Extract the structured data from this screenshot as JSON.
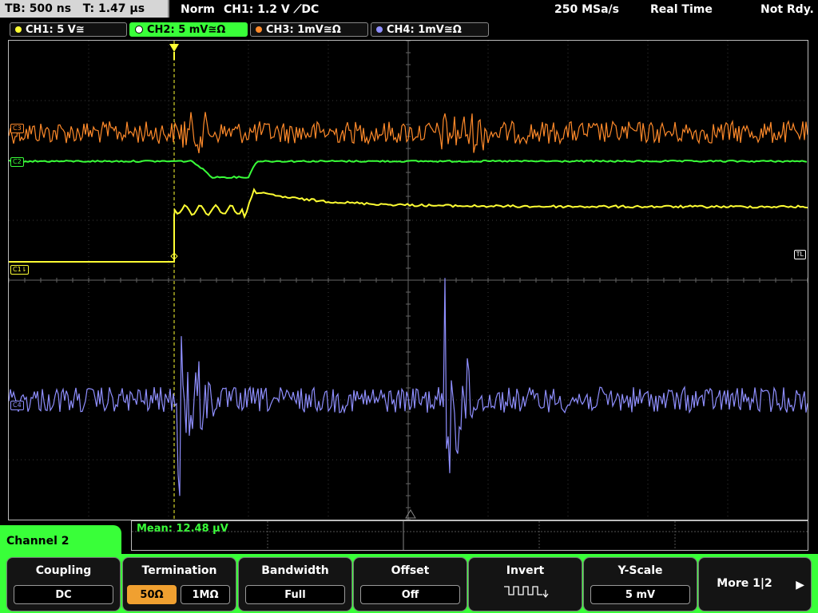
{
  "topbar": {
    "timebase": "TB: 500 ns",
    "trigger_pos": "T: 1.47 µs",
    "mode": "Norm",
    "trigger_info": "CH1: 1.2 V ⟋DC",
    "sample_rate": "250 MSa/s",
    "acq_mode": "Real Time",
    "status": "Not Rdy."
  },
  "channels": [
    {
      "label": "CH1: 5 V≅",
      "color": "#ffff33",
      "active": false
    },
    {
      "label": "CH2: 5 mV≅Ω",
      "color": "#39ff39",
      "active": true
    },
    {
      "label": "CH3: 1mV≅Ω",
      "color": "#ff8a2a",
      "active": false
    },
    {
      "label": "CH4: 1mV≅Ω",
      "color": "#8f8fff",
      "active": false
    }
  ],
  "waveform_markers": {
    "c1": "C1⇂",
    "c2": "C2",
    "c3": "C3",
    "c4": "C4",
    "trigger_level": "TL"
  },
  "measurement": {
    "mean": "Mean: 12.48 µV"
  },
  "panel_title": "Channel 2",
  "softkeys": {
    "coupling": {
      "label": "Coupling",
      "value": "DC"
    },
    "termination": {
      "label": "Termination",
      "opt1": "50Ω",
      "opt2": "1MΩ",
      "selected": "50Ω"
    },
    "bandwidth": {
      "label": "Bandwidth",
      "value": "Full"
    },
    "offset": {
      "label": "Offset",
      "value": "Off"
    },
    "invert": {
      "label": "Invert"
    },
    "yscale": {
      "label": "Y-Scale",
      "value": "5 mV"
    },
    "more": {
      "label": "More 1|2"
    }
  }
}
